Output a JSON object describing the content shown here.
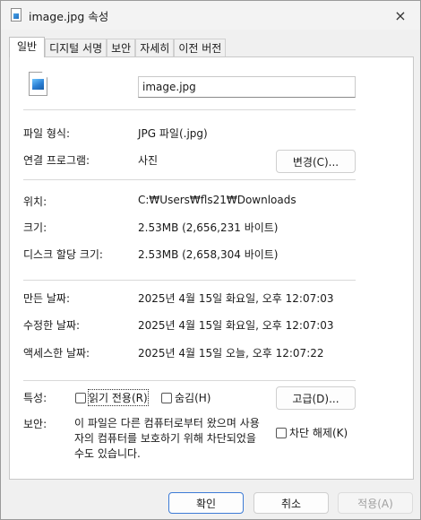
{
  "window": {
    "title": "image.jpg 속성",
    "close_icon": "×"
  },
  "tabs": [
    {
      "label": "일반",
      "active": true
    },
    {
      "label": "디지털 서명",
      "active": false
    },
    {
      "label": "보안",
      "active": false
    },
    {
      "label": "자세히",
      "active": false
    },
    {
      "label": "이전 버전",
      "active": false
    }
  ],
  "general": {
    "file_icon": "image-file-icon",
    "file_name": "image.jpg",
    "file_type_label": "파일 형식:",
    "file_type_value": "JPG 파일(.jpg)",
    "open_with_label": "연결 프로그램:",
    "open_with_value": "사진",
    "change_button": "변경(C)...",
    "location_label": "위치:",
    "location_value": "C:₩Users₩fls21₩Downloads",
    "size_label": "크기:",
    "size_value": "2.53MB (2,656,231 바이트)",
    "size_on_disk_label": "디스크 할당 크기:",
    "size_on_disk_value": "2.53MB (2,658,304 바이트)",
    "created_label": "만든 날짜:",
    "created_value": "2025년 4월 15일 화요일, 오후 12:07:03",
    "modified_label": "수정한 날짜:",
    "modified_value": "2025년 4월 15일 화요일, 오후 12:07:03",
    "accessed_label": "액세스한 날짜:",
    "accessed_value": "2025년 4월 15일 오늘, 오후 12:07:22",
    "attributes_label": "특성:",
    "readonly_label": "읽기 전용(R)",
    "hidden_label": "숨김(H)",
    "advanced_button": "고급(D)...",
    "security_label": "보안:",
    "security_text": "이 파일은 다른 컴퓨터로부터 왔으며 사용자의 컴퓨터를 보호하기 위해 차단되었을 수도 있습니다.",
    "unblock_label": "차단 해제(K)"
  },
  "footer": {
    "ok": "확인",
    "cancel": "취소",
    "apply": "적용(A)"
  },
  "colors": {
    "accent": "#3d7bd6",
    "panel": "#ffffff",
    "background": "#f0f0f0"
  }
}
